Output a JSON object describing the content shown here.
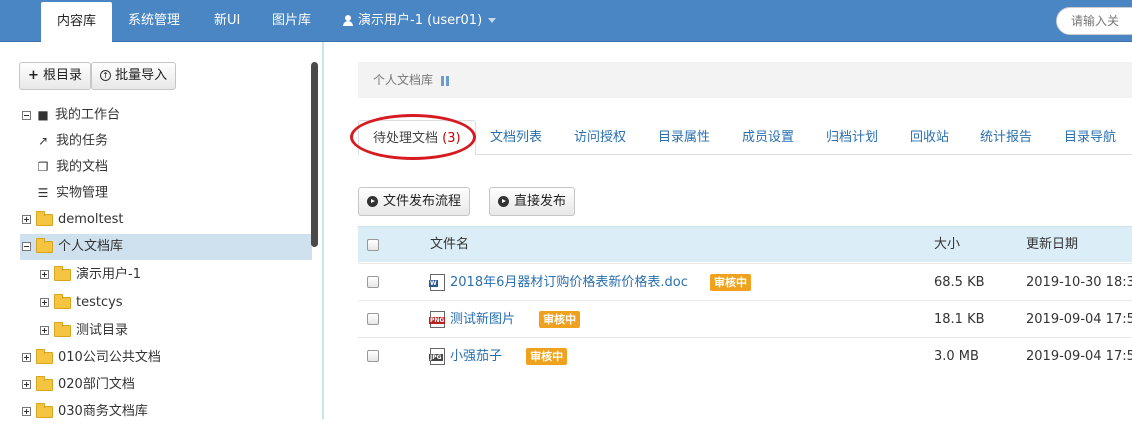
{
  "topnav": {
    "items": [
      {
        "label": "内容库",
        "active": true
      },
      {
        "label": "系统管理"
      },
      {
        "label": "新UI"
      },
      {
        "label": "图片库"
      }
    ],
    "user_label": "演示用户-1 (user01)",
    "search_placeholder": "请输入关"
  },
  "sidebar": {
    "root_button": "根目录",
    "import_button": "批量导入",
    "tree": [
      {
        "label": "我的工作台",
        "icon": "briefcase-icon"
      },
      {
        "label": "我的任务",
        "icon": "external-link-icon"
      },
      {
        "label": "我的文档",
        "icon": "copy-icon"
      },
      {
        "label": "实物管理",
        "icon": "list-icon"
      },
      {
        "label": "demoltest",
        "icon": "folder-icon"
      },
      {
        "label": "个人文档库",
        "icon": "folder-icon",
        "selected": true
      },
      {
        "label": "演示用户-1",
        "icon": "folder-icon"
      },
      {
        "label": "testcys",
        "icon": "folder-icon"
      },
      {
        "label": "测试目录",
        "icon": "folder-icon"
      },
      {
        "label": "010公司公共文档",
        "icon": "folder-icon"
      },
      {
        "label": "020部门文档",
        "icon": "folder-icon"
      },
      {
        "label": "030商务文档库",
        "icon": "folder-icon"
      }
    ]
  },
  "breadcrumb": {
    "label": "个人文档库"
  },
  "tabs": [
    {
      "label": "待处理文档",
      "count": "(3)",
      "active": true
    },
    {
      "label": "文档列表"
    },
    {
      "label": "访问授权"
    },
    {
      "label": "目录属性"
    },
    {
      "label": "成员设置"
    },
    {
      "label": "归档计划"
    },
    {
      "label": "回收站"
    },
    {
      "label": "统计报告"
    },
    {
      "label": "目录导航"
    }
  ],
  "actions": {
    "publish_flow": "文件发布流程",
    "direct_publish": "直接发布"
  },
  "table": {
    "headers": {
      "name": "文件名",
      "size": "大小",
      "updated": "更新日期"
    },
    "rows": [
      {
        "name": "2018年6月器材订购价格表新价格表.doc",
        "type": "doc",
        "badge": "审核中",
        "size": "68.5 KB",
        "updated": "2019-10-30 18:3"
      },
      {
        "name": "测试新图片",
        "type": "png",
        "badge": "审核中",
        "size": "18.1 KB",
        "updated": "2019-09-04 17:5"
      },
      {
        "name": "小强茄子",
        "type": "jpg",
        "badge": "审核中",
        "size": "3.0 MB",
        "updated": "2019-09-04 17:5"
      }
    ]
  },
  "colors": {
    "nav_bg": "#4a85c4",
    "link": "#2a6fb0",
    "badge": "#f0a11d",
    "highlight": "#d71920",
    "table_head": "#dbedf6"
  }
}
